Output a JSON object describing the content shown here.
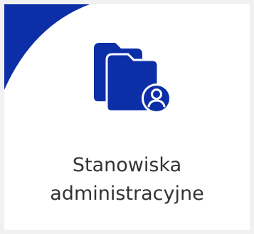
{
  "tile": {
    "label_line1": "Stanowiska",
    "label_line2": "administracyjne",
    "icon": "folder-user-icon",
    "accent_color": "#0c2fa8",
    "text_color": "#333333"
  }
}
